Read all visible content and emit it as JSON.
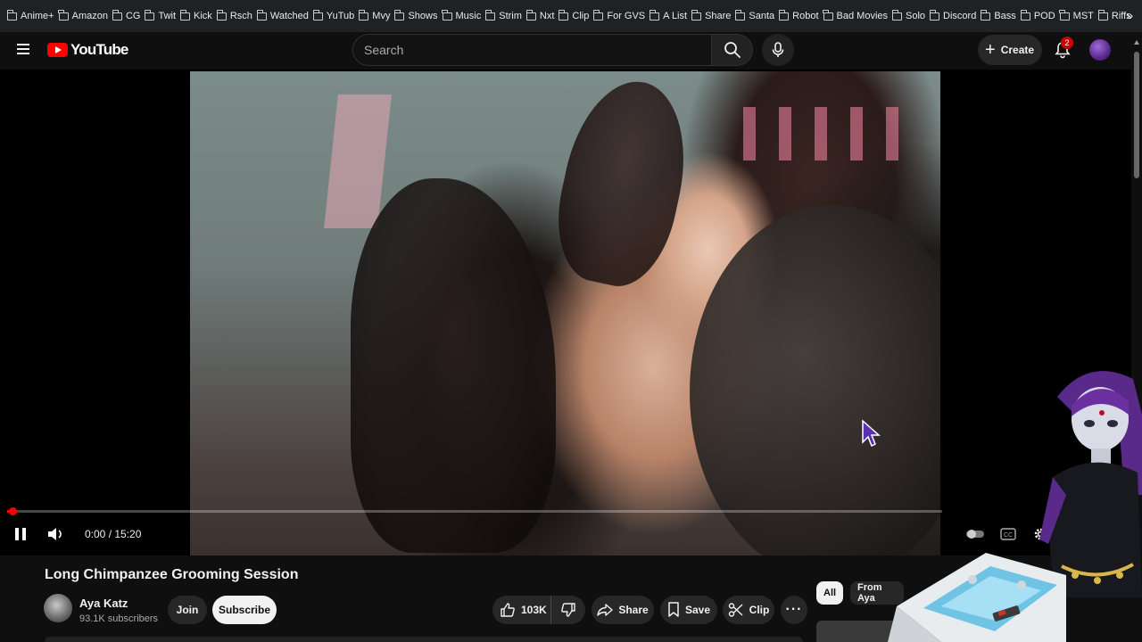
{
  "bookmarks": [
    {
      "label": "Anime+"
    },
    {
      "label": "Amazon"
    },
    {
      "label": "CG"
    },
    {
      "label": "Twit"
    },
    {
      "label": "Kick"
    },
    {
      "label": "Rsch"
    },
    {
      "label": "Watched"
    },
    {
      "label": "YuTub"
    },
    {
      "label": "Mvy"
    },
    {
      "label": "Shows"
    },
    {
      "label": "Music"
    },
    {
      "label": "Strim"
    },
    {
      "label": "Nxt"
    },
    {
      "label": "Clip"
    },
    {
      "label": "For GVS"
    },
    {
      "label": "A List"
    },
    {
      "label": "Share"
    },
    {
      "label": "Santa"
    },
    {
      "label": "Robot"
    },
    {
      "label": "Bad Movies"
    },
    {
      "label": "Solo"
    },
    {
      "label": "Discord"
    },
    {
      "label": "Bass"
    },
    {
      "label": "POD"
    },
    {
      "label": "MST"
    },
    {
      "label": "Riffs"
    }
  ],
  "header": {
    "logo_text": "YouTube",
    "search_placeholder": "Search",
    "create_label": "Create",
    "notification_count": "2"
  },
  "player": {
    "current_time": "0:00",
    "duration": "15:20",
    "time_display": "0:00 / 15:20",
    "progress_fraction": 0.006,
    "state": "playing"
  },
  "video": {
    "title": "Long Chimpanzee Grooming Session",
    "channel_name": "Aya Katz",
    "subscribers": "93.1K subscribers",
    "join_label": "Join",
    "subscribe_label": "Subscribe",
    "like_count": "103K",
    "share_label": "Share",
    "save_label": "Save",
    "clip_label": "Clip"
  },
  "chips": [
    {
      "label": "All",
      "selected": true
    },
    {
      "label": "From Aya",
      "selected": false
    }
  ],
  "colors": {
    "background": "#0f0f0f",
    "brand_red": "#ff0000",
    "button_bg": "#272727",
    "subscribe_bg": "#f1f1f1"
  },
  "icons": {
    "menu": "hamburger-icon",
    "search": "search-icon",
    "mic": "microphone-icon",
    "bell": "bell-icon",
    "pause": "pause-icon",
    "volume": "volume-icon",
    "like": "thumbs-up-icon",
    "dislike": "thumbs-down-icon",
    "share": "share-arrow-icon",
    "save": "bookmark-icon",
    "clip": "scissors-icon",
    "settings": "gear-icon",
    "captions": "captions-icon"
  }
}
